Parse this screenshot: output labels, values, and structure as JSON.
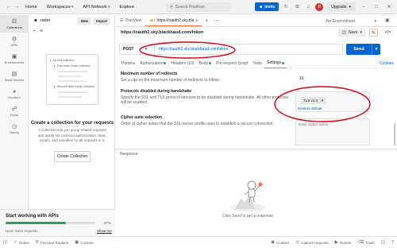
{
  "topbar": {
    "nav": [
      "Home",
      "Workspaces",
      "API Network",
      "Explore"
    ],
    "search_placeholder": "Search Postman",
    "invite_label": "Invite",
    "upgrade_label": "Upgrade"
  },
  "rail": {
    "items": [
      "Collections",
      "APIs",
      "Environments",
      "Mock Servers",
      "Monitors",
      "Flows",
      "History"
    ]
  },
  "sidebar": {
    "workspace_name": "rader",
    "new_label": "New",
    "import_label": "Import",
    "illustration": {
      "collection_label": "My first collection",
      "folder1_label": "First folder inside collection",
      "folder2_label": "Second folder inside collection"
    },
    "title": "Create a collection for your requests",
    "description": "A collection lets you group related requests and easily set common authorization, tests, scripts, and variables for all requests in it.",
    "create_button": "Create Collection"
  },
  "onboarding": {
    "title": "Start working with APIs",
    "progress_percent": 67,
    "progress_text": "67%",
    "next_text": "Next: Save requests.",
    "show_label": "Show me"
  },
  "tabs": {
    "overview_label": "Overview",
    "active_method": "GET",
    "active_url": "https://oauth2.sky.bla",
    "environment": "No Environment"
  },
  "request": {
    "title": "https://oauth2.sky.blackbaud.com/token",
    "save_label": "Save",
    "method": "POST",
    "url": "https://oauth2.sky.blackbaud.com/token",
    "send_label": "Send",
    "tabs": [
      {
        "label": "Params",
        "dot": false
      },
      {
        "label": "Authorization",
        "dot": true
      },
      {
        "label": "Headers (10)",
        "dot": false
      },
      {
        "label": "Body",
        "dot": true
      },
      {
        "label": "Pre-request Script",
        "dot": false
      },
      {
        "label": "Tests",
        "dot": false
      },
      {
        "label": "Settings",
        "dot": true
      }
    ],
    "cookies_label": "Cookies"
  },
  "settings": {
    "redirects": {
      "title": "Maximum number of redirects",
      "desc": "Set a cap on the maximum number of redirects to follow.",
      "value": "10"
    },
    "protocols": {
      "title": "Protocols disabled during handshake",
      "desc": "Specify the SSL and TLS protocol versions to be disabled during handshake. All other protocols will be enabled.",
      "chip": "TLS v1.3",
      "reset_label": "Restore default"
    },
    "cipher": {
      "title": "Cipher suite selection",
      "desc": "Order of cipher suites that the SSL server profile uses to establish a secure connection.",
      "placeholder": "Enter cipher suites"
    }
  },
  "response": {
    "label": "Response",
    "hint": "Click Send to get a response"
  },
  "statusbar": {
    "left": [
      "Online",
      "Find and Replace",
      "Console"
    ],
    "right": [
      "Cookies",
      "Capture requests",
      "Runner",
      "Trash"
    ]
  },
  "colors": {
    "accent": "#ff6c37",
    "primary": "#0265d2",
    "success": "#2aa35a",
    "annotation": "#d90012"
  }
}
